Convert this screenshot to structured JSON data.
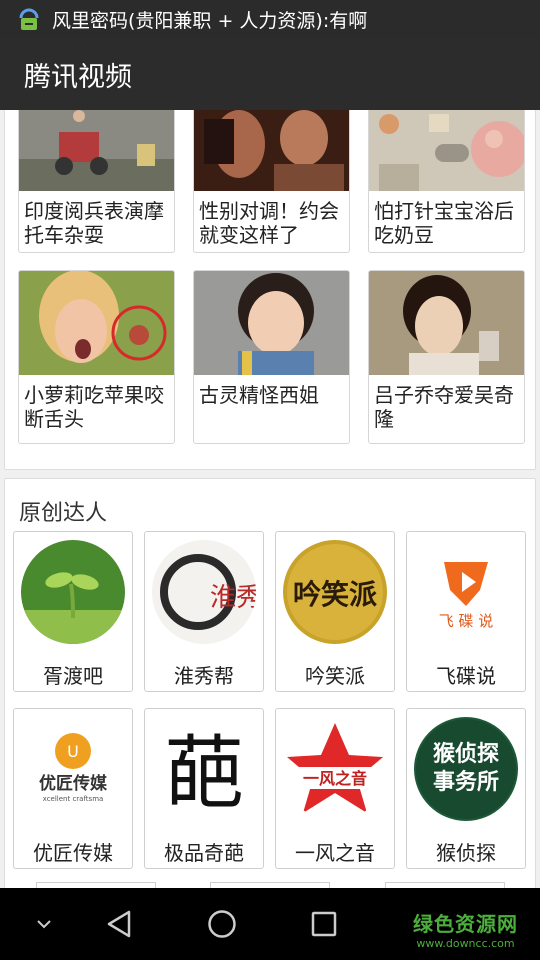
{
  "status_bar": {
    "notification_icon": "robot-lock-icon",
    "text": "风里密码(贵阳兼职 + 人力资源):有啊"
  },
  "app_bar": {
    "title": "腾讯视频"
  },
  "videos": [
    {
      "title": "印度阅兵表演摩托车杂耍"
    },
    {
      "title": "性别对调！约会就变这样了"
    },
    {
      "title": "怕打针宝宝浴后吃奶豆"
    },
    {
      "title": "小萝莉吃苹果咬断舌头"
    },
    {
      "title": "古灵精怪西姐"
    },
    {
      "title": "吕子乔夺爱吴奇隆"
    }
  ],
  "creators_section": {
    "title": "原创达人",
    "items": [
      {
        "name": "胥渡吧",
        "logo_text": ""
      },
      {
        "name": "淮秀帮",
        "logo_text": "淮秀帮"
      },
      {
        "name": "吟笑派",
        "logo_text": "吟笑派"
      },
      {
        "name": "飞碟说",
        "logo_text": "飞 碟 说"
      },
      {
        "name": "优匠传媒",
        "logo_text": "优匠传媒",
        "logo_subtext": "xcellent craftsma"
      },
      {
        "name": "极品奇葩",
        "logo_text": "葩"
      },
      {
        "name": "一风之音",
        "logo_text": "一风之音"
      },
      {
        "name": "猴侦探",
        "logo_text": "猴侦探事务所"
      }
    ]
  },
  "nav_bar": {
    "buttons": [
      "collapse-icon",
      "back-icon",
      "home-icon",
      "recents-icon"
    ]
  },
  "watermark": {
    "main": "绿色资源网",
    "sub": "www.downcc.com"
  },
  "colors": {
    "status_bar": "#2b2b2b",
    "app_bar": "#2c2c2c",
    "background": "#f0f0f0",
    "watermark": "#4cae3c"
  }
}
